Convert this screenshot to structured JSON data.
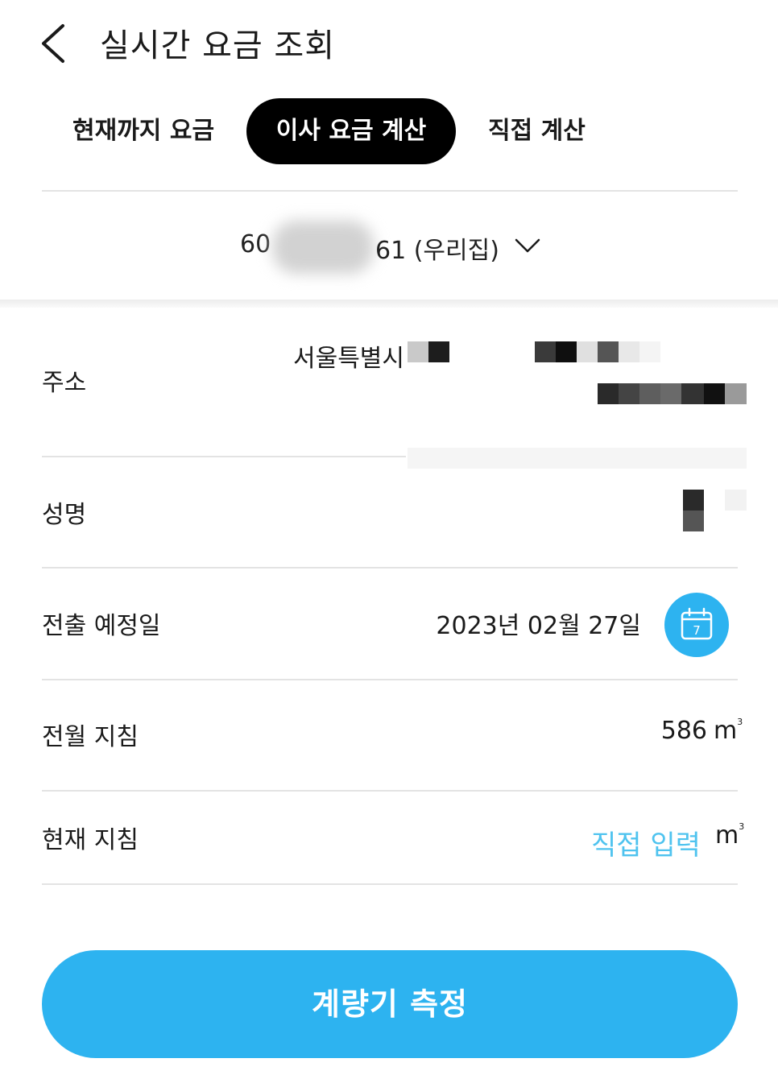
{
  "header": {
    "title": "실시간 요금 조회",
    "back_icon": "chevron-left-icon"
  },
  "tabs": [
    {
      "label": "현재까지 요금",
      "selected": false
    },
    {
      "label": "이사 요금 계산",
      "selected": true
    },
    {
      "label": "직접 계산",
      "selected": false
    }
  ],
  "account": {
    "prefix": "60",
    "suffix": "61 (우리집)",
    "dropdown_icon": "chevron-down-icon"
  },
  "rows": {
    "address": {
      "label": "주소",
      "value": "서울특별시"
    },
    "name": {
      "label": "성명"
    },
    "move_out_date": {
      "label": "전출 예정일",
      "value": "2023년 02월 27일",
      "calendar_day": "7"
    },
    "prev_reading": {
      "label": "전월 지침",
      "value": "586",
      "unit": "m"
    },
    "current_reading": {
      "label": "현재 지침",
      "placeholder": "직접 입력",
      "unit": "m"
    }
  },
  "cta": {
    "label": "계량기 측정"
  },
  "colors": {
    "accent": "#2db3f0",
    "tab_active_bg": "#000000",
    "link": "#4fc3ef"
  }
}
